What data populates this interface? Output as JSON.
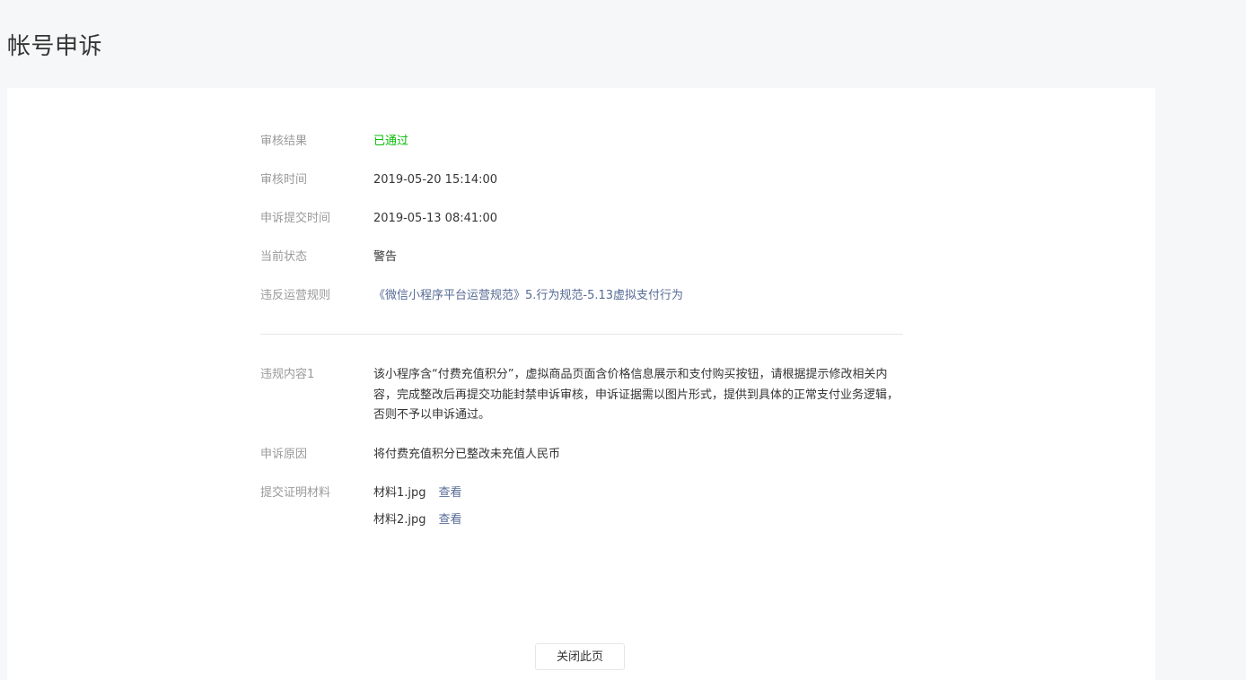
{
  "page": {
    "title": "帐号申诉"
  },
  "details": {
    "review_result": {
      "label": "审核结果",
      "value": "已通过"
    },
    "review_time": {
      "label": "审核时间",
      "value": "2019-05-20 15:14:00"
    },
    "submit_time": {
      "label": "申诉提交时间",
      "value": "2019-05-13 08:41:00"
    },
    "current_status": {
      "label": "当前状态",
      "value": "警告"
    },
    "violated_rule": {
      "label": "违反运营规则",
      "value": "《微信小程序平台运营规范》5.行为规范-5.13虚拟支付行为"
    },
    "violation_content": {
      "label": "违规内容1",
      "value": "该小程序含“付费充值积分”，虚拟商品页面含价格信息展示和支付购买按钮，请根据提示修改相关内容，完成整改后再提交功能封禁申诉审核，申诉证据需以图片形式，提供到具体的正常支付业务逻辑，否则不予以申诉通过。"
    },
    "appeal_reason": {
      "label": "申诉原因",
      "value": "将付费充值积分已整改未充值人民币"
    },
    "evidence": {
      "label": "提交证明材料",
      "files": [
        {
          "name": "材料1.jpg",
          "action": "查看"
        },
        {
          "name": "材料2.jpg",
          "action": "查看"
        }
      ]
    }
  },
  "actions": {
    "close_label": "关闭此页"
  },
  "colors": {
    "success": "#09bb07",
    "link": "#576b95",
    "label": "#9a9a9a",
    "text": "#353535"
  }
}
